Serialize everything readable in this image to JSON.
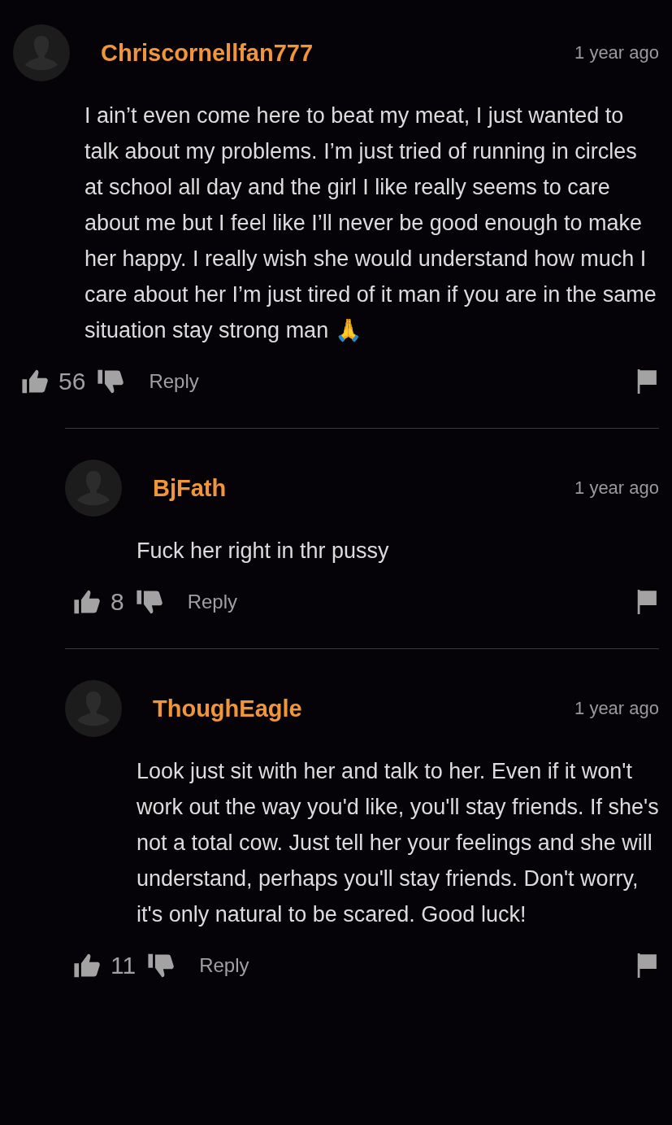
{
  "comments": [
    {
      "author": "Chriscornellfan777",
      "time": "1 year ago",
      "body": "I ain’t even come here to beat my meat, I just wanted to talk about my problems. I’m just tried of running in circles at school all day and the girl I like really seems to care about me but I feel like I’ll never be good enough to make her happy. I really wish she would understand how much I care about her I’m just tired of it man if you are in the same situation stay strong man 🙏",
      "likes": "56",
      "reply": "Reply",
      "children": [
        {
          "author": "BjFath",
          "time": "1 year ago",
          "body": "Fuck her right in thr pussy",
          "likes": "8",
          "reply": "Reply"
        },
        {
          "author": "ThoughEagle",
          "time": "1 year ago",
          "body": "Look just sit with her and talk to her. Even if it won't work out the way you'd like, you'll stay friends. If she's not a total cow. Just tell her your feelings and she will understand, perhaps you'll stay friends. Don't worry, it's only natural to be scared. Good luck!",
          "likes": "11",
          "reply": "Reply"
        }
      ]
    }
  ]
}
